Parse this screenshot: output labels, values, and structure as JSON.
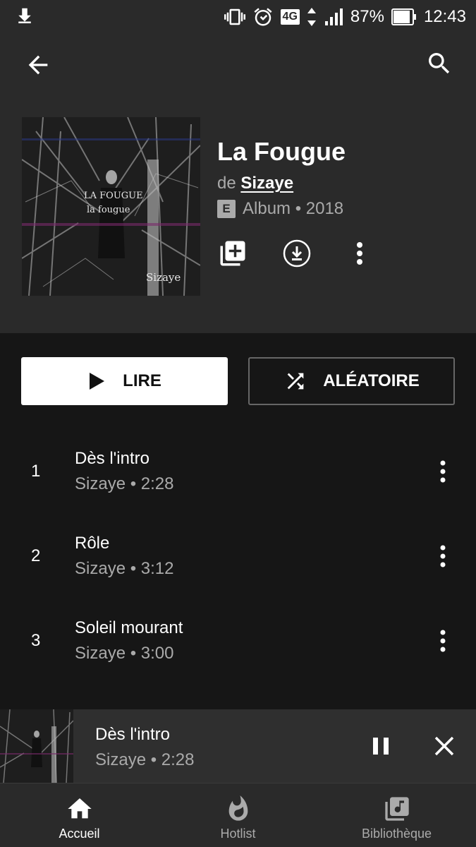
{
  "status_bar": {
    "battery": "87%",
    "time": "12:43",
    "network": "4G"
  },
  "album": {
    "title": "La Fougue",
    "by_prefix": "de",
    "artist": "Sizaye",
    "explicit_badge": "E",
    "meta": "Album • 2018",
    "cover_text": {
      "line1": "LA FOUGUE",
      "line2": "la fougue",
      "signature": "Sizaye"
    }
  },
  "actions": {
    "play_label": "LIRE",
    "shuffle_label": "ALÉATOIRE"
  },
  "tracks": [
    {
      "number": "1",
      "title": "Dès l'intro",
      "subtitle": "Sizaye • 2:28"
    },
    {
      "number": "2",
      "title": "Rôle",
      "subtitle": "Sizaye • 3:12"
    },
    {
      "number": "3",
      "title": "Soleil mourant",
      "subtitle": "Sizaye • 3:00"
    }
  ],
  "now_playing": {
    "title": "Dès l'intro",
    "subtitle": "Sizaye • 2:28"
  },
  "nav": [
    {
      "label": "Accueil",
      "icon": "home-icon"
    },
    {
      "label": "Hotlist",
      "icon": "flame-icon"
    },
    {
      "label": "Bibliothèque",
      "icon": "library-music-icon"
    }
  ],
  "colors": {
    "header_bg": "#2a2a2a",
    "page_bg": "#161616",
    "mini_player_bg": "#2f2f2f",
    "secondary_text": "#aaaaaa"
  }
}
